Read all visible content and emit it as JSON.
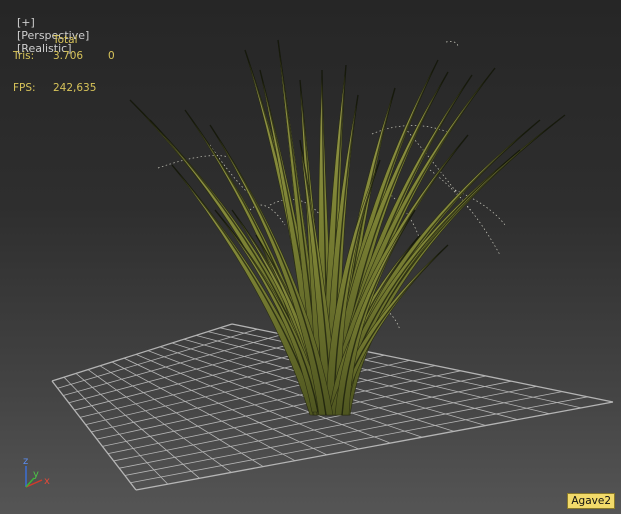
{
  "viewport": {
    "menu_plus": "[+]",
    "menu_view": "[Perspective]",
    "menu_shading": "[Realistic]"
  },
  "stats": {
    "total_header": "Total",
    "tris_label": "Tris:",
    "tris_total": "3.706",
    "tris_selected": "0",
    "fps_label": "FPS:",
    "fps_value": "242,635"
  },
  "axis": {
    "x": "x",
    "y": "y",
    "z": "z"
  },
  "selected_object": "Agave2",
  "colors": {
    "stat_text": "#d8c45a",
    "blade_fill": "#7d8335",
    "grid_line": "#c8c8c8",
    "axis_x": "#d23a2a",
    "axis_y": "#39b536",
    "axis_z": "#3b6fd6"
  }
}
